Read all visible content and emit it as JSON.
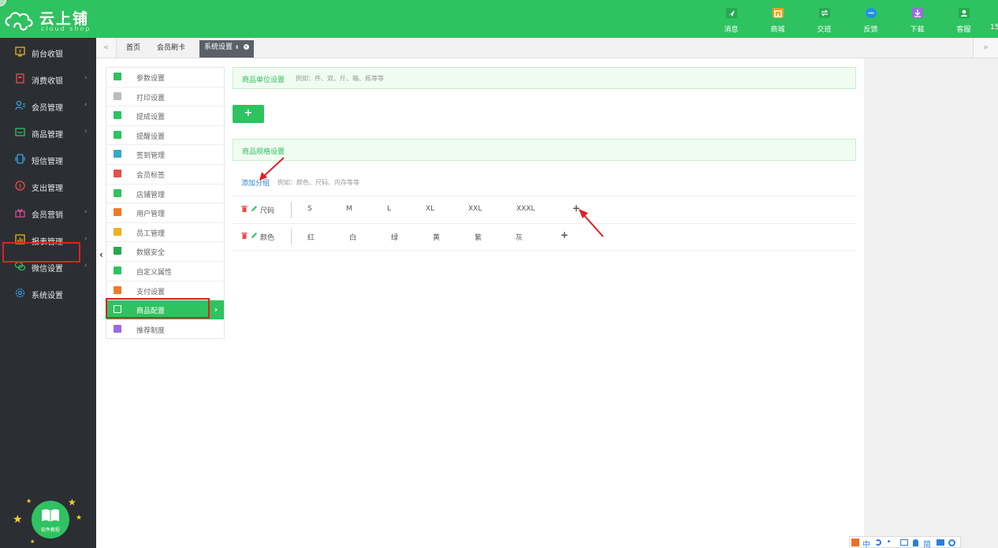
{
  "brand": {
    "name": "云上铺",
    "sub": "cloud shop"
  },
  "top_actions": [
    {
      "label": "消息",
      "icon": "message-icon",
      "color": "#27a84f"
    },
    {
      "label": "商城",
      "icon": "store-icon",
      "color": "#e8a21b"
    },
    {
      "label": "交班",
      "icon": "shift-icon",
      "color": "#27a84f"
    },
    {
      "label": "反馈",
      "icon": "feedback-icon",
      "color": "#1e90e8"
    },
    {
      "label": "下载",
      "icon": "download-icon",
      "color": "#9a6be0"
    },
    {
      "label": "客服",
      "icon": "service-icon",
      "color": "#27a84f"
    }
  ],
  "top_extra": "15",
  "sidebar": {
    "items": [
      {
        "label": "前台收银",
        "icon": "cashier-icon",
        "chevron": ""
      },
      {
        "label": "消费收银",
        "icon": "consume-icon",
        "chevron": "‹"
      },
      {
        "label": "会员管理",
        "icon": "member-icon",
        "chevron": "‹"
      },
      {
        "label": "商品管理",
        "icon": "goods-icon",
        "chevron": "‹"
      },
      {
        "label": "短信管理",
        "icon": "sms-icon",
        "chevron": ""
      },
      {
        "label": "支出管理",
        "icon": "expense-icon",
        "chevron": ""
      },
      {
        "label": "会员营销",
        "icon": "marketing-icon",
        "chevron": "‹"
      },
      {
        "label": "报表管理",
        "icon": "report-icon",
        "chevron": "‹"
      },
      {
        "label": "微信设置",
        "icon": "wechat-icon",
        "chevron": "‹"
      },
      {
        "label": "系统设置",
        "icon": "settings-icon",
        "chevron": ""
      }
    ],
    "tutorial_label": "软件教程"
  },
  "tabs": {
    "nav_left": "«",
    "nav_right": "»",
    "items": [
      "首页",
      "会员刷卡",
      "系统设置"
    ],
    "active_pin": "⇟"
  },
  "settings_menu": {
    "items": [
      {
        "label": "参数设置",
        "color": "#2fc260"
      },
      {
        "label": "打印设置",
        "color": "#bbbbbb"
      },
      {
        "label": "提成设置",
        "color": "#2fc260"
      },
      {
        "label": "提醒设置",
        "color": "#2fc260"
      },
      {
        "label": "签到管理",
        "color": "#37a8c8"
      },
      {
        "label": "会员标签",
        "color": "#e84d4d"
      },
      {
        "label": "店铺管理",
        "color": "#2fc260"
      },
      {
        "label": "用户管理",
        "color": "#f07a2a"
      },
      {
        "label": "员工管理",
        "color": "#f0b020"
      },
      {
        "label": "数据安全",
        "color": "#27a84f"
      },
      {
        "label": "自定义属性",
        "color": "#2fc260"
      },
      {
        "label": "支付设置",
        "color": "#f07a2a"
      },
      {
        "label": "商品配置",
        "color": "#2fc260"
      },
      {
        "label": "推荐制度",
        "color": "#9a6be0"
      }
    ],
    "active_arrow": "›"
  },
  "unit_panel": {
    "title": "商品单位设置",
    "hint": "例如：件、双、斤、箱、瓶等等"
  },
  "add_unit_button": "+",
  "spec_panel": {
    "title": "商品规格设置"
  },
  "add_group": {
    "label": "添加分组",
    "hint": "例如：颜色、尺码、内存等等"
  },
  "spec_groups": [
    {
      "name": "尺码",
      "values": [
        "S",
        "M",
        "L",
        "XL",
        "XXL",
        "XXXL"
      ],
      "plus": "+"
    },
    {
      "name": "颜色",
      "values": [
        "红",
        "白",
        "绿",
        "黄",
        "紫",
        "灰"
      ],
      "plus": "+"
    }
  ],
  "ime": {
    "chars": [
      "中",
      "简"
    ]
  },
  "colors": {
    "brand": "#2fc260",
    "sidebar": "#2b2f33",
    "annotation": "#e02020"
  }
}
